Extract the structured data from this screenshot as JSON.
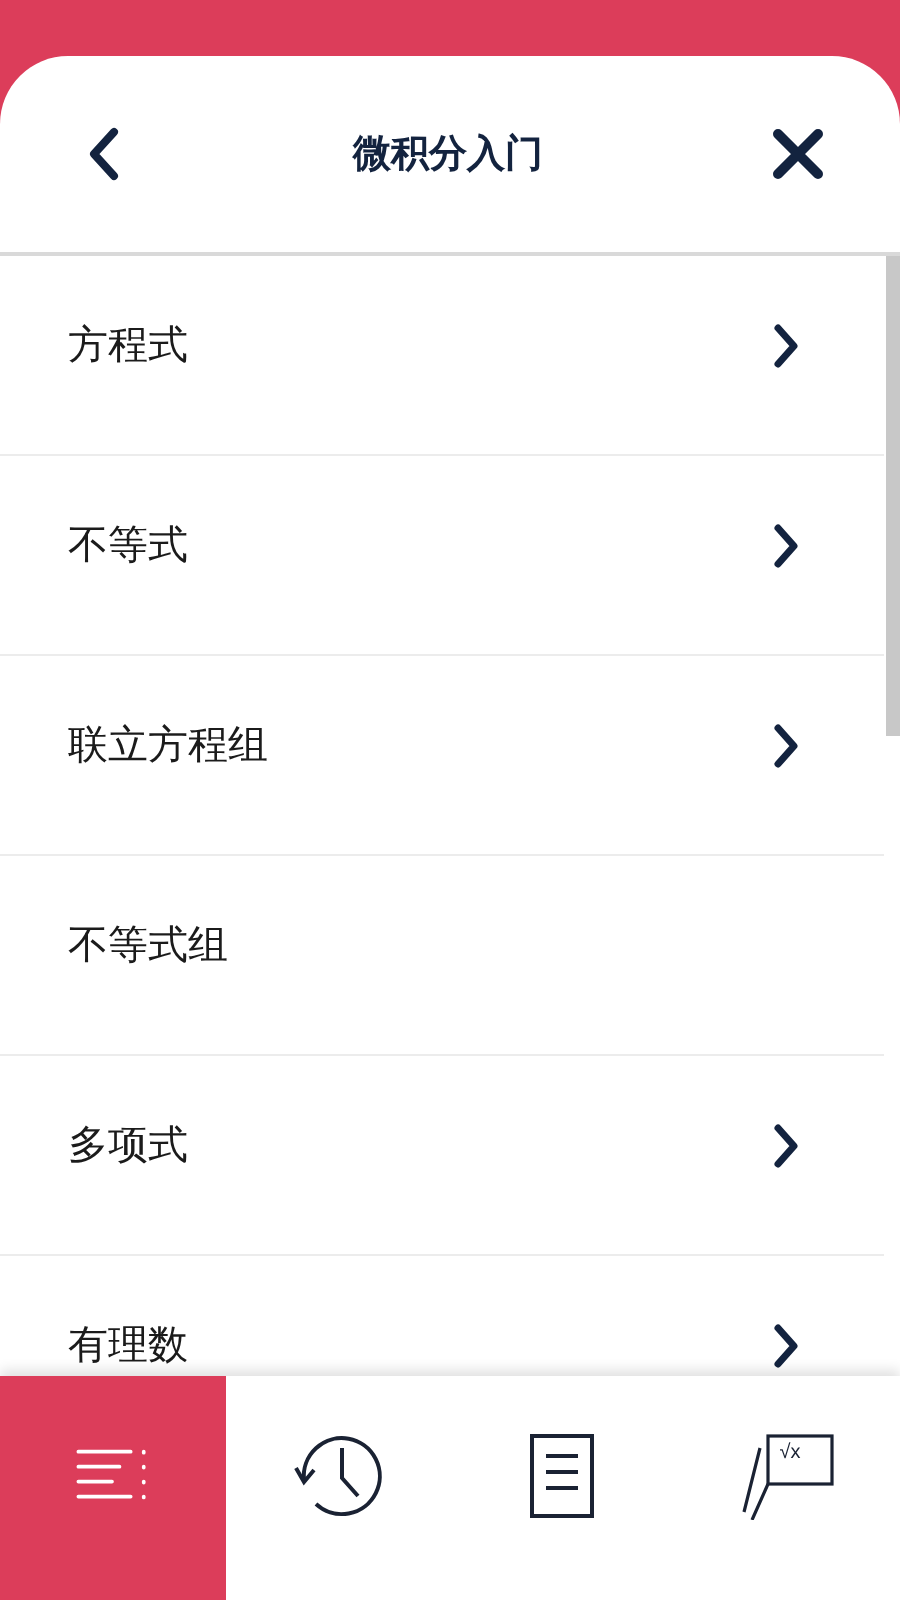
{
  "header": {
    "title": "微积分入门"
  },
  "items": [
    {
      "label": "方程式",
      "has_children": true
    },
    {
      "label": "不等式",
      "has_children": true
    },
    {
      "label": "联立方程组",
      "has_children": true
    },
    {
      "label": "不等式组",
      "has_children": false
    },
    {
      "label": "多项式",
      "has_children": true
    },
    {
      "label": "有理数",
      "has_children": true
    }
  ],
  "tabs": [
    {
      "kind": "menu",
      "selected": true
    },
    {
      "kind": "history",
      "selected": false
    },
    {
      "kind": "document",
      "selected": false
    },
    {
      "kind": "formula",
      "selected": false,
      "icon_text": "√x"
    }
  ]
}
